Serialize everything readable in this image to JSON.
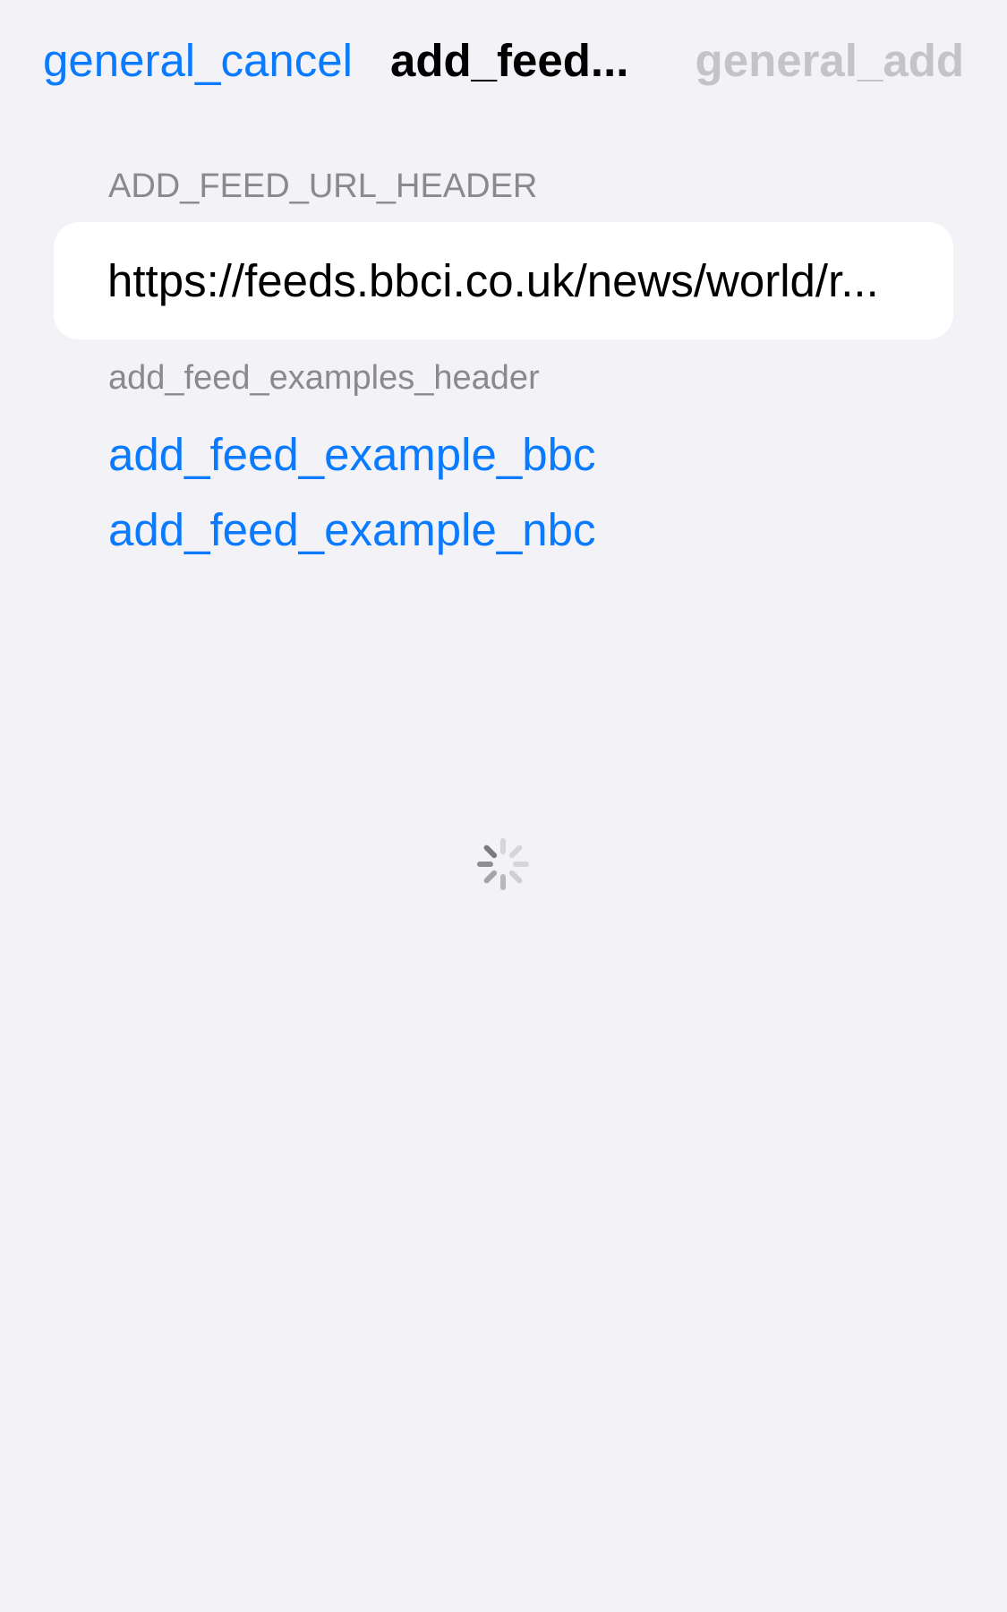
{
  "nav": {
    "cancel_label": "general_cancel",
    "title": "add_feed...",
    "add_label": "general_add"
  },
  "url_section": {
    "header": "ADD_FEED_URL_HEADER",
    "value": "https://feeds.bbci.co.uk/news/world/r..."
  },
  "examples": {
    "header": "add_feed_examples_header",
    "items": [
      {
        "label": "add_feed_example_bbc"
      },
      {
        "label": "add_feed_example_nbc"
      }
    ]
  },
  "loading": {
    "icon": "activity-spinner-icon"
  },
  "colors": {
    "background": "#f2f2f7",
    "accent": "#0a7aff",
    "disabled": "#c4c4c7",
    "secondary_text": "#8a8a8e",
    "field_background": "#ffffff"
  }
}
